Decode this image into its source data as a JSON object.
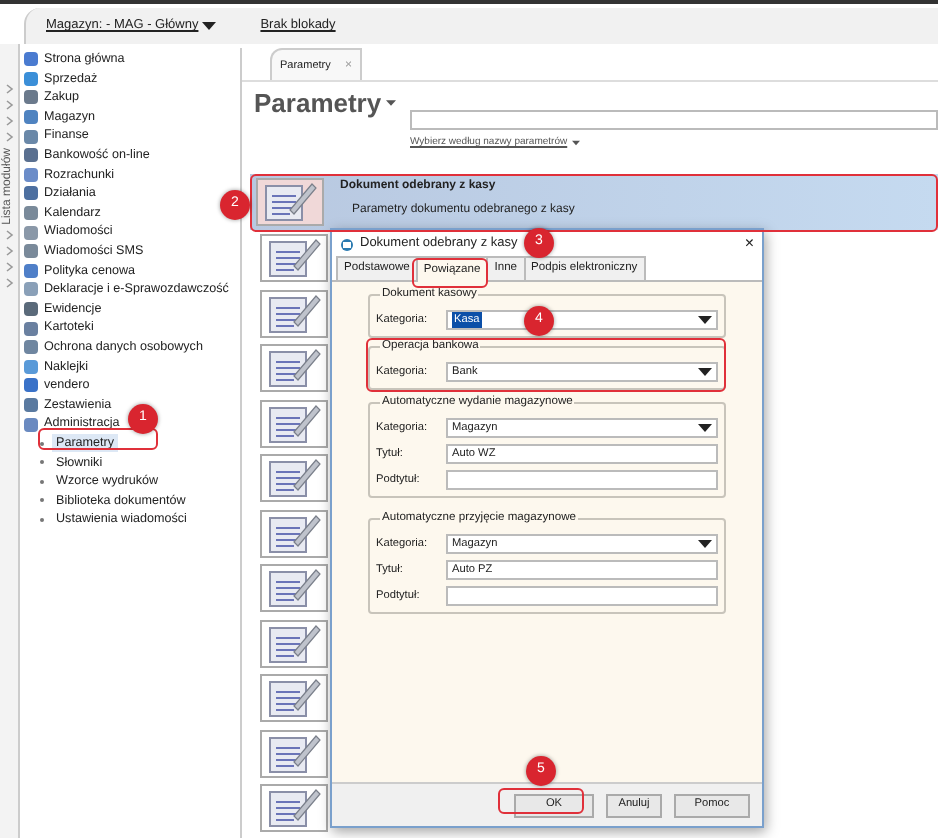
{
  "top_bar": {
    "warehouse": "Magazyn: - MAG - Główny",
    "lock_status": "Brak blokady"
  },
  "module_strip": {
    "label": "Lista modułów"
  },
  "sidebar": {
    "items": [
      {
        "label": "Strona główna"
      },
      {
        "label": "Sprzedaż"
      },
      {
        "label": "Zakup"
      },
      {
        "label": "Magazyn"
      },
      {
        "label": "Finanse"
      },
      {
        "label": "Bankowość on-line"
      },
      {
        "label": "Rozrachunki"
      },
      {
        "label": "Działania"
      },
      {
        "label": "Kalendarz"
      },
      {
        "label": "Wiadomości"
      },
      {
        "label": "Wiadomości SMS"
      },
      {
        "label": "Polityka cenowa"
      },
      {
        "label": "Deklaracje i e-Sprawozdawczość"
      },
      {
        "label": "Ewidencje"
      },
      {
        "label": "Kartoteki"
      },
      {
        "label": "Ochrona danych osobowych"
      },
      {
        "label": "Naklejki"
      },
      {
        "label": "vendero"
      },
      {
        "label": "Zestawienia"
      },
      {
        "label": "Administracja",
        "children": [
          {
            "label": "Parametry",
            "selected": true
          },
          {
            "label": "Słowniki",
            "selected": false
          },
          {
            "label": "Wzorce wydruków",
            "selected": false
          },
          {
            "label": "Biblioteka dokumentów",
            "selected": false
          },
          {
            "label": "Ustawienia wiadomości",
            "selected": false
          }
        ]
      }
    ]
  },
  "tab": {
    "label": "Parametry",
    "close": "×"
  },
  "heading": "Parametry",
  "search": {
    "link": "Wybierz według nazwy parametrów"
  },
  "parameter_rows": [
    {
      "title": "Dokument odebrany z kasy",
      "subtitle": "Parametry dokumentu odebranego z kasy",
      "selected": true
    }
  ],
  "dialog": {
    "title": "Dokument odebrany z kasy",
    "close": "×",
    "tabs": [
      {
        "label": "Podstawowe",
        "selected": false
      },
      {
        "label": "Powiązane",
        "selected": true
      },
      {
        "label": "Inne",
        "selected": false
      },
      {
        "label": "Podpis elektroniczny",
        "selected": false
      }
    ],
    "groups": [
      {
        "title": "Dokument kasowy",
        "fields": [
          {
            "kind": "dropdown",
            "label": "Kategoria:",
            "value": "Kasa",
            "highlighted": true
          }
        ]
      },
      {
        "title": "Operacja bankowa",
        "fields": [
          {
            "kind": "dropdown",
            "label": "Kategoria:",
            "value": "Bank",
            "highlighted": false
          }
        ]
      },
      {
        "title": "Automatyczne wydanie magazynowe",
        "fields": [
          {
            "kind": "dropdown",
            "label": "Kategoria:",
            "value": "Magazyn",
            "highlighted": false
          },
          {
            "kind": "text",
            "label": "Tytuł:",
            "value": "Auto WZ"
          },
          {
            "kind": "text",
            "label": "Podtytuł:"
          }
        ]
      },
      {
        "title": "Automatyczne przyjęcie magazynowe",
        "fields": [
          {
            "kind": "dropdown",
            "label": "Kategoria:",
            "value": "Magazyn",
            "highlighted": false
          },
          {
            "kind": "text",
            "label": "Tytuł:",
            "value": "Auto PZ"
          },
          {
            "kind": "text",
            "label": "Podtytuł:"
          }
        ]
      }
    ],
    "buttons": [
      "OK",
      "Anuluj",
      "Pomoc"
    ]
  },
  "annotations": [
    {
      "number": "1"
    },
    {
      "number": "2"
    },
    {
      "number": "3"
    },
    {
      "number": "4"
    },
    {
      "number": "5"
    }
  ]
}
